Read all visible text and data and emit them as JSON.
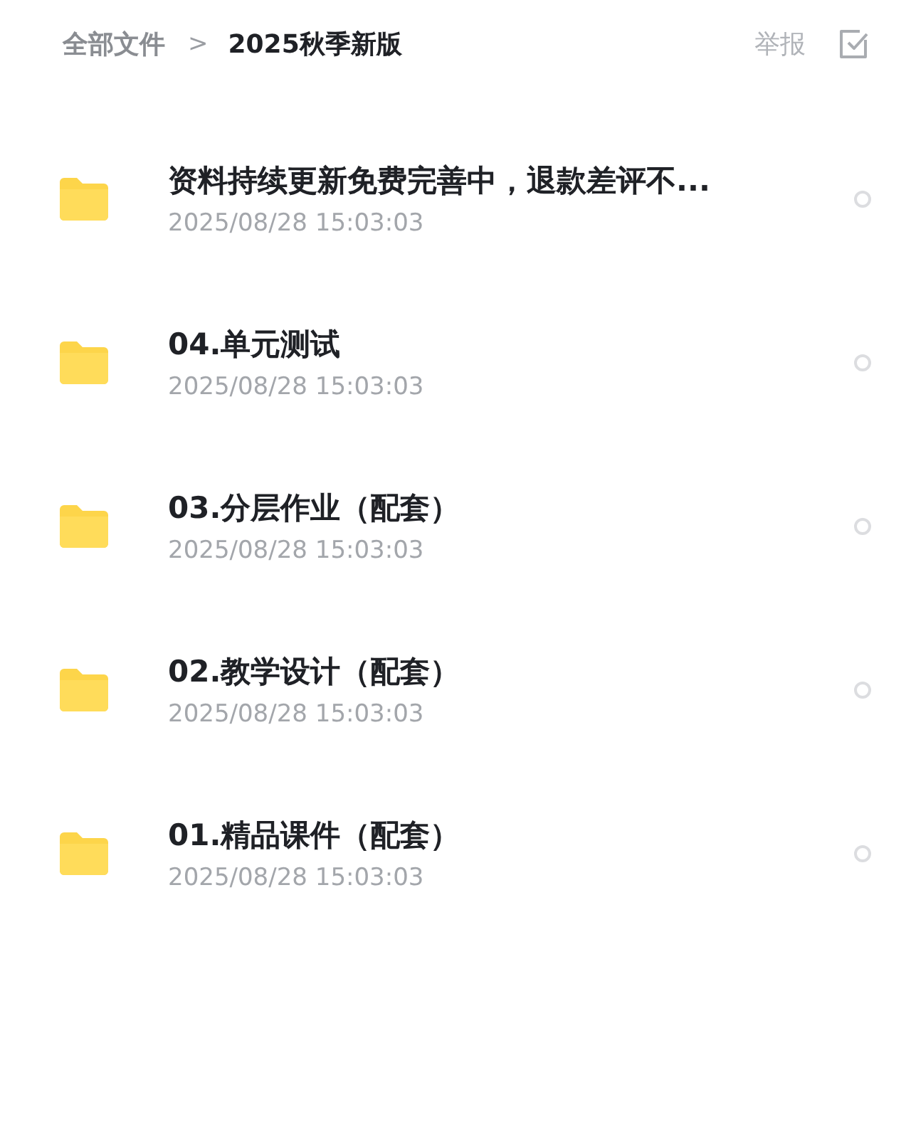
{
  "breadcrumb": {
    "root": "全部文件",
    "separator": ">",
    "current": "2025秋季新版"
  },
  "actions": {
    "report": "举报"
  },
  "files": [
    {
      "name": "资料持续更新免费完善中，退款差评不...",
      "date": "2025/08/28 15:03:03",
      "selected": false
    },
    {
      "name": "04.单元测试",
      "date": "2025/08/28 15:03:03",
      "selected": false
    },
    {
      "name": "03.分层作业（配套）",
      "date": "2025/08/28 15:03:03",
      "selected": false
    },
    {
      "name": "02.教学设计（配套）",
      "date": "2025/08/28 15:03:03",
      "selected": false
    },
    {
      "name": "01.精品课件（配套）",
      "date": "2025/08/28 15:03:03",
      "selected": false
    }
  ]
}
